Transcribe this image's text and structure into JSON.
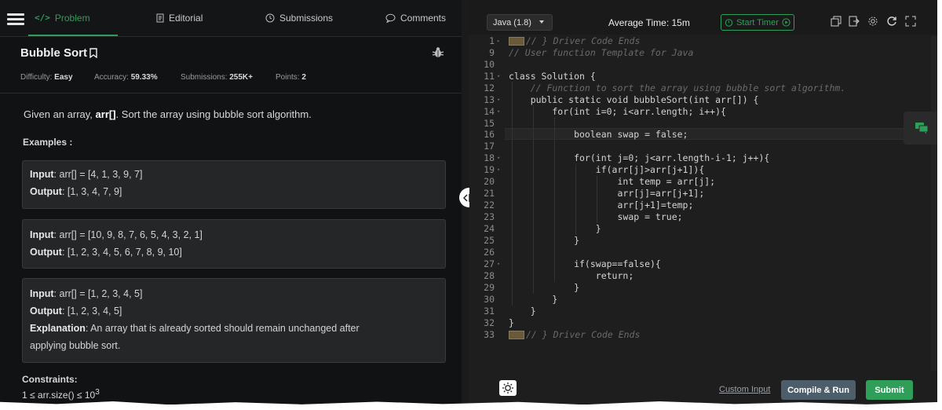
{
  "nav": {
    "tabs": [
      {
        "label": "Problem",
        "icon": "code-icon"
      },
      {
        "label": "Editorial",
        "icon": "document-icon"
      },
      {
        "label": "Submissions",
        "icon": "clock-icon"
      },
      {
        "label": "Comments",
        "icon": "comment-icon"
      }
    ]
  },
  "problem": {
    "title": "Bubble Sort",
    "meta": {
      "difficulty_label": "Difficulty:",
      "difficulty": "Easy",
      "accuracy_label": "Accuracy:",
      "accuracy": "59.33%",
      "submissions_label": "Submissions:",
      "submissions": "255K+",
      "points_label": "Points:",
      "points": "2"
    },
    "description": {
      "pre": "Given an array, ",
      "bold": "arr[]",
      "post": ". Sort the array using bubble sort algorithm."
    },
    "examples_heading": "Examples :",
    "examples": [
      {
        "input_label": "Input",
        "input": ":  arr[]  =  [4,  1,  3,  9,  7]",
        "output_label": "Output",
        "output": ":  [1,  3,  4,  7,  9]"
      },
      {
        "input_label": "Input",
        "input": ":  arr[]  =  [10,  9,  8,  7,  6,  5,  4,  3,  2,  1]",
        "output_label": "Output",
        "output": ":  [1,  2,  3,  4,  5,  6,  7,  8,  9,  10]"
      },
      {
        "input_label": "Input",
        "input": ":  arr[]  =  [1,  2,  3,  4,  5]",
        "output_label": "Output",
        "output": ":  [1,  2,  3,  4,  5]",
        "explanation_label": "Explanation",
        "explanation_1": ":  An  array  that  is  already  sorted  should  remain  unchanged  after",
        "explanation_2": "applying  bubble  sort."
      }
    ],
    "constraints_heading": "Constraints:",
    "constraint_partial": "1 ≤ arr.size() ≤ 10",
    "constraint_exp": "3"
  },
  "editor": {
    "language": "Java (1.8)",
    "average_time": "Average Time: 15m",
    "timer_label": "Start Timer",
    "lines": [
      {
        "n": "1",
        "fold": "▸"
      },
      {
        "n": "9",
        "fold": ""
      },
      {
        "n": "10",
        "fold": ""
      },
      {
        "n": "11",
        "fold": "▾"
      },
      {
        "n": "12",
        "fold": ""
      },
      {
        "n": "13",
        "fold": "▾"
      },
      {
        "n": "14",
        "fold": "▾"
      },
      {
        "n": "15",
        "fold": ""
      },
      {
        "n": "16",
        "fold": ""
      },
      {
        "n": "17",
        "fold": ""
      },
      {
        "n": "18",
        "fold": "▾"
      },
      {
        "n": "19",
        "fold": "▾"
      },
      {
        "n": "20",
        "fold": ""
      },
      {
        "n": "21",
        "fold": ""
      },
      {
        "n": "22",
        "fold": ""
      },
      {
        "n": "23",
        "fold": ""
      },
      {
        "n": "24",
        "fold": ""
      },
      {
        "n": "25",
        "fold": ""
      },
      {
        "n": "26",
        "fold": ""
      },
      {
        "n": "27",
        "fold": "▾"
      },
      {
        "n": "28",
        "fold": ""
      },
      {
        "n": "29",
        "fold": ""
      },
      {
        "n": "30",
        "fold": ""
      },
      {
        "n": "31",
        "fold": ""
      },
      {
        "n": "32",
        "fold": ""
      },
      {
        "n": "33",
        "fold": ""
      }
    ],
    "code": {
      "l1": "// } Driver Code Ends",
      "l9": "// User function Template for Java",
      "l11": "class Solution {",
      "l12": "    // Function to sort the array using bubble sort algorithm.",
      "l13": "    public static void bubbleSort(int arr[]) {",
      "l14": "        for(int i=0; i<arr.length; i++){",
      "l16": "            boolean swap = false;",
      "l18": "            for(int j=0; j<arr.length-i-1; j++){",
      "l19": "                if(arr[j]>arr[j+1]){",
      "l20": "                    int temp = arr[j];",
      "l21": "                    arr[j]=arr[j+1];",
      "l22": "                    arr[j+1]=temp;",
      "l23": "                    swap = true;",
      "l24": "                }",
      "l25": "            }",
      "l27": "            if(swap==false){",
      "l28": "                return;",
      "l29": "            }",
      "l30": "        }",
      "l31": "    }",
      "l32": "}",
      "l33": "// } Driver Code Ends"
    }
  },
  "footer": {
    "custom_input": "Custom Input",
    "compile_run": "Compile & Run",
    "submit": "Submit"
  },
  "colors": {
    "accent_green": "#2f9e59",
    "compile_btn": "#4d5e6b",
    "panel_bg": "#111213",
    "editor_bg": "#1e1e1e"
  }
}
